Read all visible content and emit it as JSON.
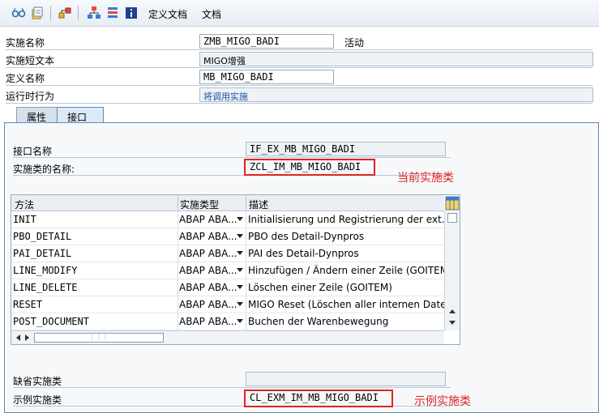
{
  "toolbar": {
    "items": [
      {
        "icon": "glasses-icon"
      },
      {
        "icon": "edit-toggle-icon"
      },
      {
        "icon": "hierarchy-icon"
      },
      {
        "icon": "org-structure-icon"
      },
      {
        "icon": "stack-icon"
      },
      {
        "icon": "info-icon"
      }
    ],
    "define_doc_label": "定义文档",
    "doc_label": "文档"
  },
  "header": {
    "impl_name_label": "实施名称",
    "impl_name_value": "ZMB_MIGO_BADI",
    "impl_status": "活动",
    "impl_short_text_label": "实施短文本",
    "impl_short_text_value": "MIGO增强",
    "def_name_label": "定义名称",
    "def_name_value": "MB_MIGO_BADI",
    "runtime_behavior_label": "运行时行为",
    "runtime_behavior_value": "将调用实施"
  },
  "tabs": [
    {
      "label": "属性",
      "active": false
    },
    {
      "label": "接口",
      "active": true
    }
  ],
  "interface": {
    "interface_name_label": "接口名称",
    "interface_name_value": "IF_EX_MB_MIGO_BADI",
    "impl_class_label": "实施类的名称:",
    "impl_class_value": "ZCL_IM_MB_MIGO_BADI",
    "impl_class_annotation": "当前实施类",
    "default_impl_class_label": "缺省实施类",
    "default_impl_class_value": "",
    "example_impl_class_label": "示例实施类",
    "example_impl_class_value": "CL_EXM_IM_MB_MIGO_BADI",
    "example_impl_class_annotation": "示例实施类"
  },
  "methods_table": {
    "columns": [
      "方法",
      "实施类型",
      "描述"
    ],
    "rows": [
      {
        "method": "INIT",
        "type": "ABAP ABA...",
        "desc": "Initialisierung und Registrierung der ext. Det"
      },
      {
        "method": "PBO_DETAIL",
        "type": "ABAP ABA...",
        "desc": "PBO des Detail-Dynpros"
      },
      {
        "method": "PAI_DETAIL",
        "type": "ABAP ABA...",
        "desc": "PAI des Detail-Dynpros"
      },
      {
        "method": "LINE_MODIFY",
        "type": "ABAP ABA...",
        "desc": "Hinzufügen / Ändern einer Zeile (GOITEM)"
      },
      {
        "method": "LINE_DELETE",
        "type": "ABAP ABA...",
        "desc": "Löschen einer Zeile (GOITEM)"
      },
      {
        "method": "RESET",
        "type": "ABAP ABA...",
        "desc": "MIGO Reset (Löschen aller internen Daten)"
      },
      {
        "method": "POST_DOCUMENT",
        "type": "ABAP ABA...",
        "desc": "Buchen der Warenbewegung"
      }
    ]
  },
  "colors": {
    "annotation_red": "#e02424",
    "tab_border": "#5f88b5",
    "link_blue": "#1a4fa0"
  }
}
